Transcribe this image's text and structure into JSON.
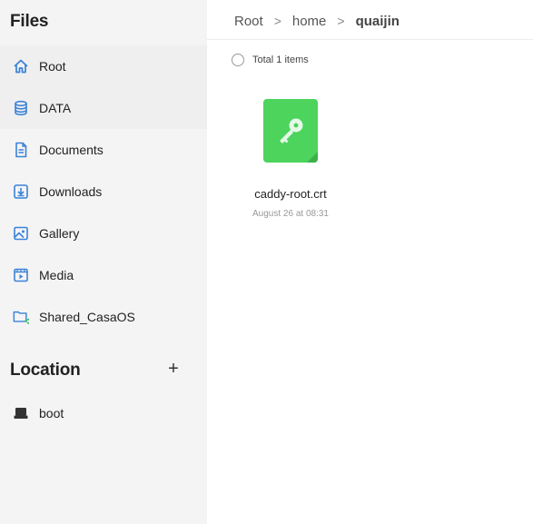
{
  "sidebar": {
    "title": "Files",
    "items": [
      {
        "label": "Root",
        "icon": "home-icon"
      },
      {
        "label": "DATA",
        "icon": "database-icon"
      },
      {
        "label": "Documents",
        "icon": "document-icon"
      },
      {
        "label": "Downloads",
        "icon": "download-icon"
      },
      {
        "label": "Gallery",
        "icon": "image-icon"
      },
      {
        "label": "Media",
        "icon": "media-icon"
      },
      {
        "label": "Shared_CasaOS",
        "icon": "shared-folder-icon"
      }
    ],
    "location": {
      "title": "Location",
      "add_label": "+",
      "items": [
        {
          "label": "boot",
          "icon": "drive-icon"
        }
      ]
    }
  },
  "breadcrumb": {
    "items": [
      "Root",
      "home",
      "quaijin"
    ],
    "separator": ">"
  },
  "main": {
    "total_text": "Total 1 items",
    "files": [
      {
        "name": "caddy-root.crt",
        "date": "August 26 at 08:31",
        "icon": "key-icon",
        "thumb_color": "#4cd45c"
      }
    ]
  },
  "colors": {
    "accent": "#3b82d6",
    "sidebar_bg": "#f4f4f5",
    "file_green": "#4cd45c"
  }
}
